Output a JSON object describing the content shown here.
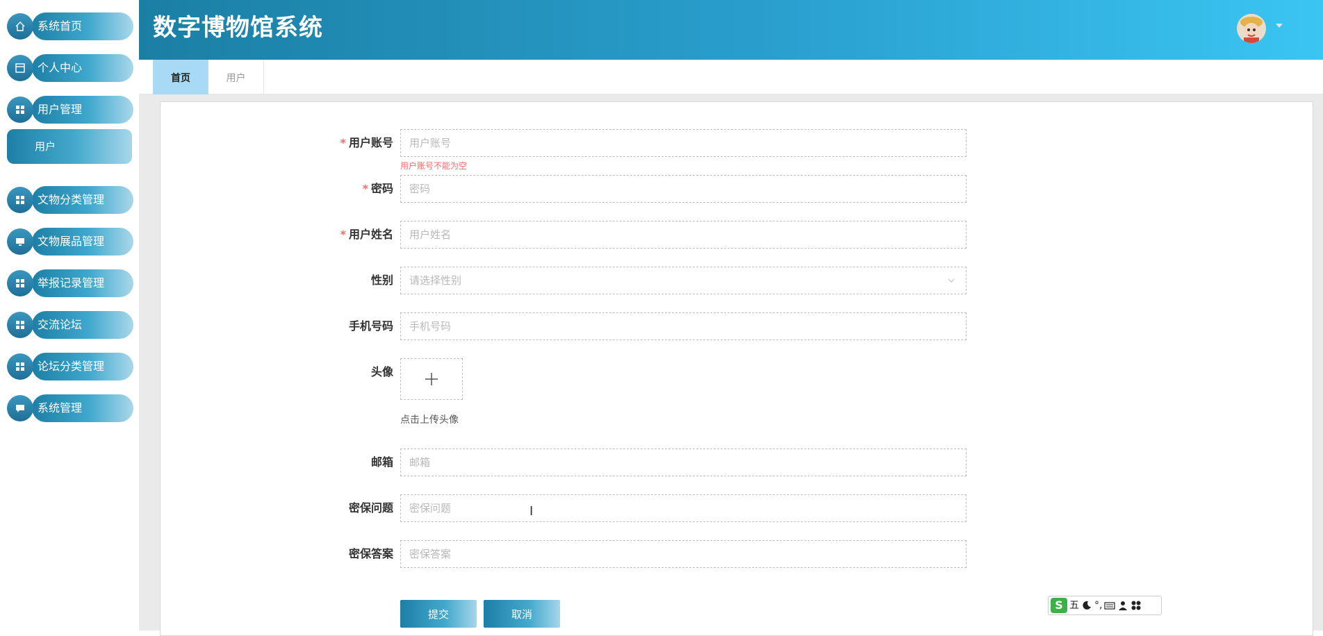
{
  "app": {
    "title": "数字博物馆系统"
  },
  "sidebar": {
    "items": [
      {
        "label": "系统首页",
        "icon": "home-icon"
      },
      {
        "label": "个人中心",
        "icon": "profile-card-icon"
      },
      {
        "label": "用户管理",
        "icon": "grid-icon"
      },
      {
        "label": "文物分类管理",
        "icon": "grid-icon"
      },
      {
        "label": "文物展品管理",
        "icon": "monitor-icon"
      },
      {
        "label": "举报记录管理",
        "icon": "grid-icon"
      },
      {
        "label": "交流论坛",
        "icon": "grid-icon"
      },
      {
        "label": "论坛分类管理",
        "icon": "grid-icon"
      },
      {
        "label": "系统管理",
        "icon": "chat-icon"
      }
    ],
    "submenu": {
      "label": "用户"
    }
  },
  "header": {
    "avatar": "user-avatar"
  },
  "tabs": [
    {
      "label": "首页",
      "active": true
    },
    {
      "label": "用户",
      "active": false
    }
  ],
  "form": {
    "account": {
      "label": "用户账号",
      "required": true,
      "placeholder": "用户账号",
      "error": "用户账号不能为空"
    },
    "password": {
      "label": "密码",
      "required": true,
      "placeholder": "密码"
    },
    "name": {
      "label": "用户姓名",
      "required": true,
      "placeholder": "用户姓名"
    },
    "gender": {
      "label": "性别",
      "placeholder": "请选择性别"
    },
    "phone": {
      "label": "手机号码",
      "placeholder": "手机号码"
    },
    "avatar": {
      "label": "头像",
      "hint": "点击上传头像"
    },
    "email": {
      "label": "邮箱",
      "placeholder": "邮箱"
    },
    "question": {
      "label": "密保问题",
      "placeholder": "密保问题"
    },
    "answer": {
      "label": "密保答案",
      "placeholder": "密保答案"
    },
    "submit_label": "提交",
    "cancel_label": "取消"
  },
  "ime": {
    "logo": "S",
    "mode": "五",
    "punct": "°,"
  },
  "colors": {
    "brand": "#2aa0cf",
    "error": "#f56c6c",
    "tab_active": "#a9daf5"
  }
}
